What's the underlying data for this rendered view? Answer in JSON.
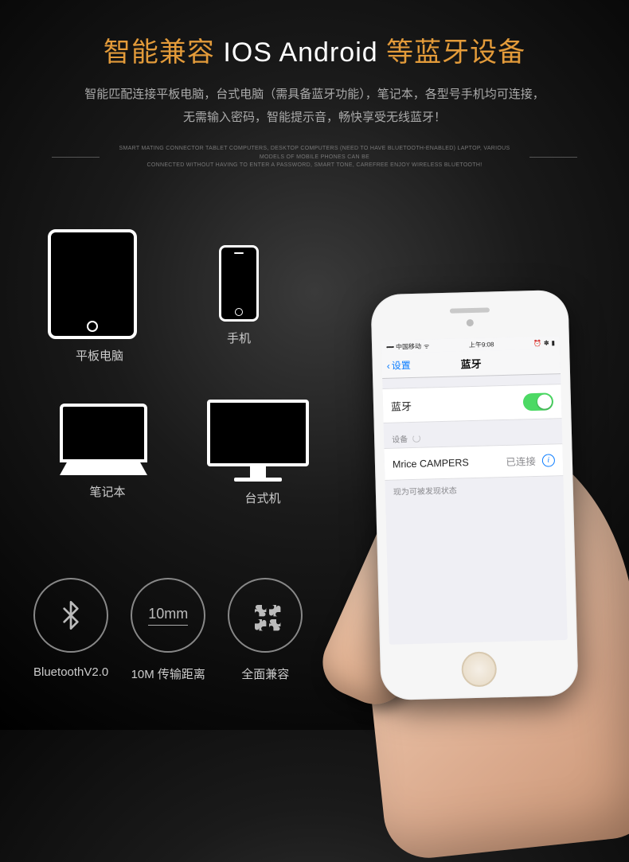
{
  "header": {
    "title_pre": "智能兼容 ",
    "title_mid": "IOS Android",
    "title_post": " 等蓝牙设备",
    "sub_line1": "智能匹配连接平板电脑，台式电脑（需具备蓝牙功能），笔记本，各型号手机均可连接，",
    "sub_line2": "无需输入密码，智能提示音，畅快享受无线蓝牙！",
    "eng_line1": "SMART MATING CONNECTOR TABLET COMPUTERS, DESKTOP COMPUTERS (NEED TO HAVE BLUETOOTH-ENABLED) LAPTOP, VARIOUS MODELS OF MOBILE PHONES CAN BE",
    "eng_line2": "CONNECTED WITHOUT HAVING TO ENTER A PASSWORD, SMART TONE, CAREFREE ENJOY WIRELESS BLUETOOTH!"
  },
  "devices": {
    "tablet": "平板电脑",
    "phone": "手机",
    "laptop": "笔记本",
    "desktop": "台式机"
  },
  "features": {
    "bt_version": "BluetoothV2.0",
    "range_value": "10mm",
    "range_label": "10M 传输距离",
    "compat_label": "全面兼容"
  },
  "phone_ui": {
    "status": {
      "carrier": "中国移动",
      "time": "上午9:08",
      "bt_glyph": "✽",
      "batt_glyph": "▮"
    },
    "nav": {
      "back": "设置",
      "title": "蓝牙"
    },
    "bt_row_label": "蓝牙",
    "devices_label": "设备",
    "device_name": "Mrice CAMPERS",
    "device_status": "已连接",
    "discoverable": "现为可被发现状态"
  }
}
